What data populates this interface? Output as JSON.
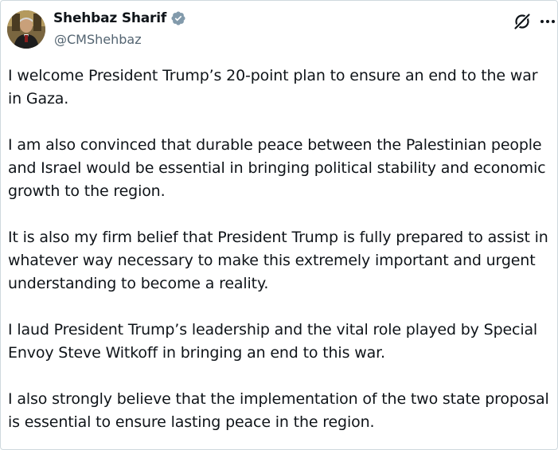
{
  "author": {
    "display_name": "Shehbaz Sharif",
    "handle": "@CMShehbaz",
    "verified": true,
    "verified_color": "#829aab"
  },
  "icons": {
    "avatar": "profile-photo",
    "verified": "verified-badge-icon",
    "grok": "grok-icon",
    "more": "more-options-icon"
  },
  "post": {
    "paragraphs": [
      "I welcome President Trump’s 20-point plan to ensure an end to the war in Gaza.",
      "I am also convinced that durable peace between the Palestinian people and Israel would be essential in bringing political stability and economic growth to the region.",
      "It is also my firm belief that President Trump is fully prepared to assist in whatever way necessary to make this extremely important and urgent understanding to become a reality.",
      "I laud President Trump’s leadership and the vital role played by Special Envoy Steve Witkoff in bringing an end to this war.",
      "I also strongly believe that the implementation of the two state proposal is essential to ensure lasting peace in the region."
    ]
  }
}
